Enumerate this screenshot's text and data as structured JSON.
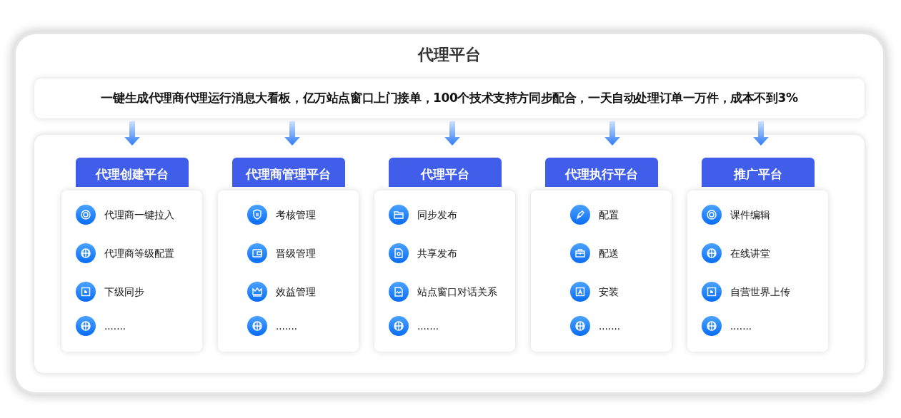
{
  "title": "代理平台",
  "banner": "一键生成代理商代理运行消息大看板，亿万站点窗口上门接单，100个技术支持方同步配合，一天自动处理订单一万件，成本不到3%",
  "platforms": [
    {
      "name": "代理创建平台",
      "items": [
        "代理商一键拉入",
        "代理商等级配置",
        "下级同步",
        "......."
      ]
    },
    {
      "name": "代理商管理平台",
      "items": [
        "考核管理",
        "晋级管理",
        "效益管理",
        "......."
      ]
    },
    {
      "name": "代理平台",
      "items": [
        "同步发布",
        "共享发布",
        "站点窗口对话关系",
        "......."
      ]
    },
    {
      "name": "代理执行平台",
      "items": [
        "配置",
        "配送",
        "安装",
        "......."
      ]
    },
    {
      "name": "推广平台",
      "items": [
        "课件编辑",
        "在线讲堂",
        "自营世界上传",
        "......."
      ]
    }
  ]
}
